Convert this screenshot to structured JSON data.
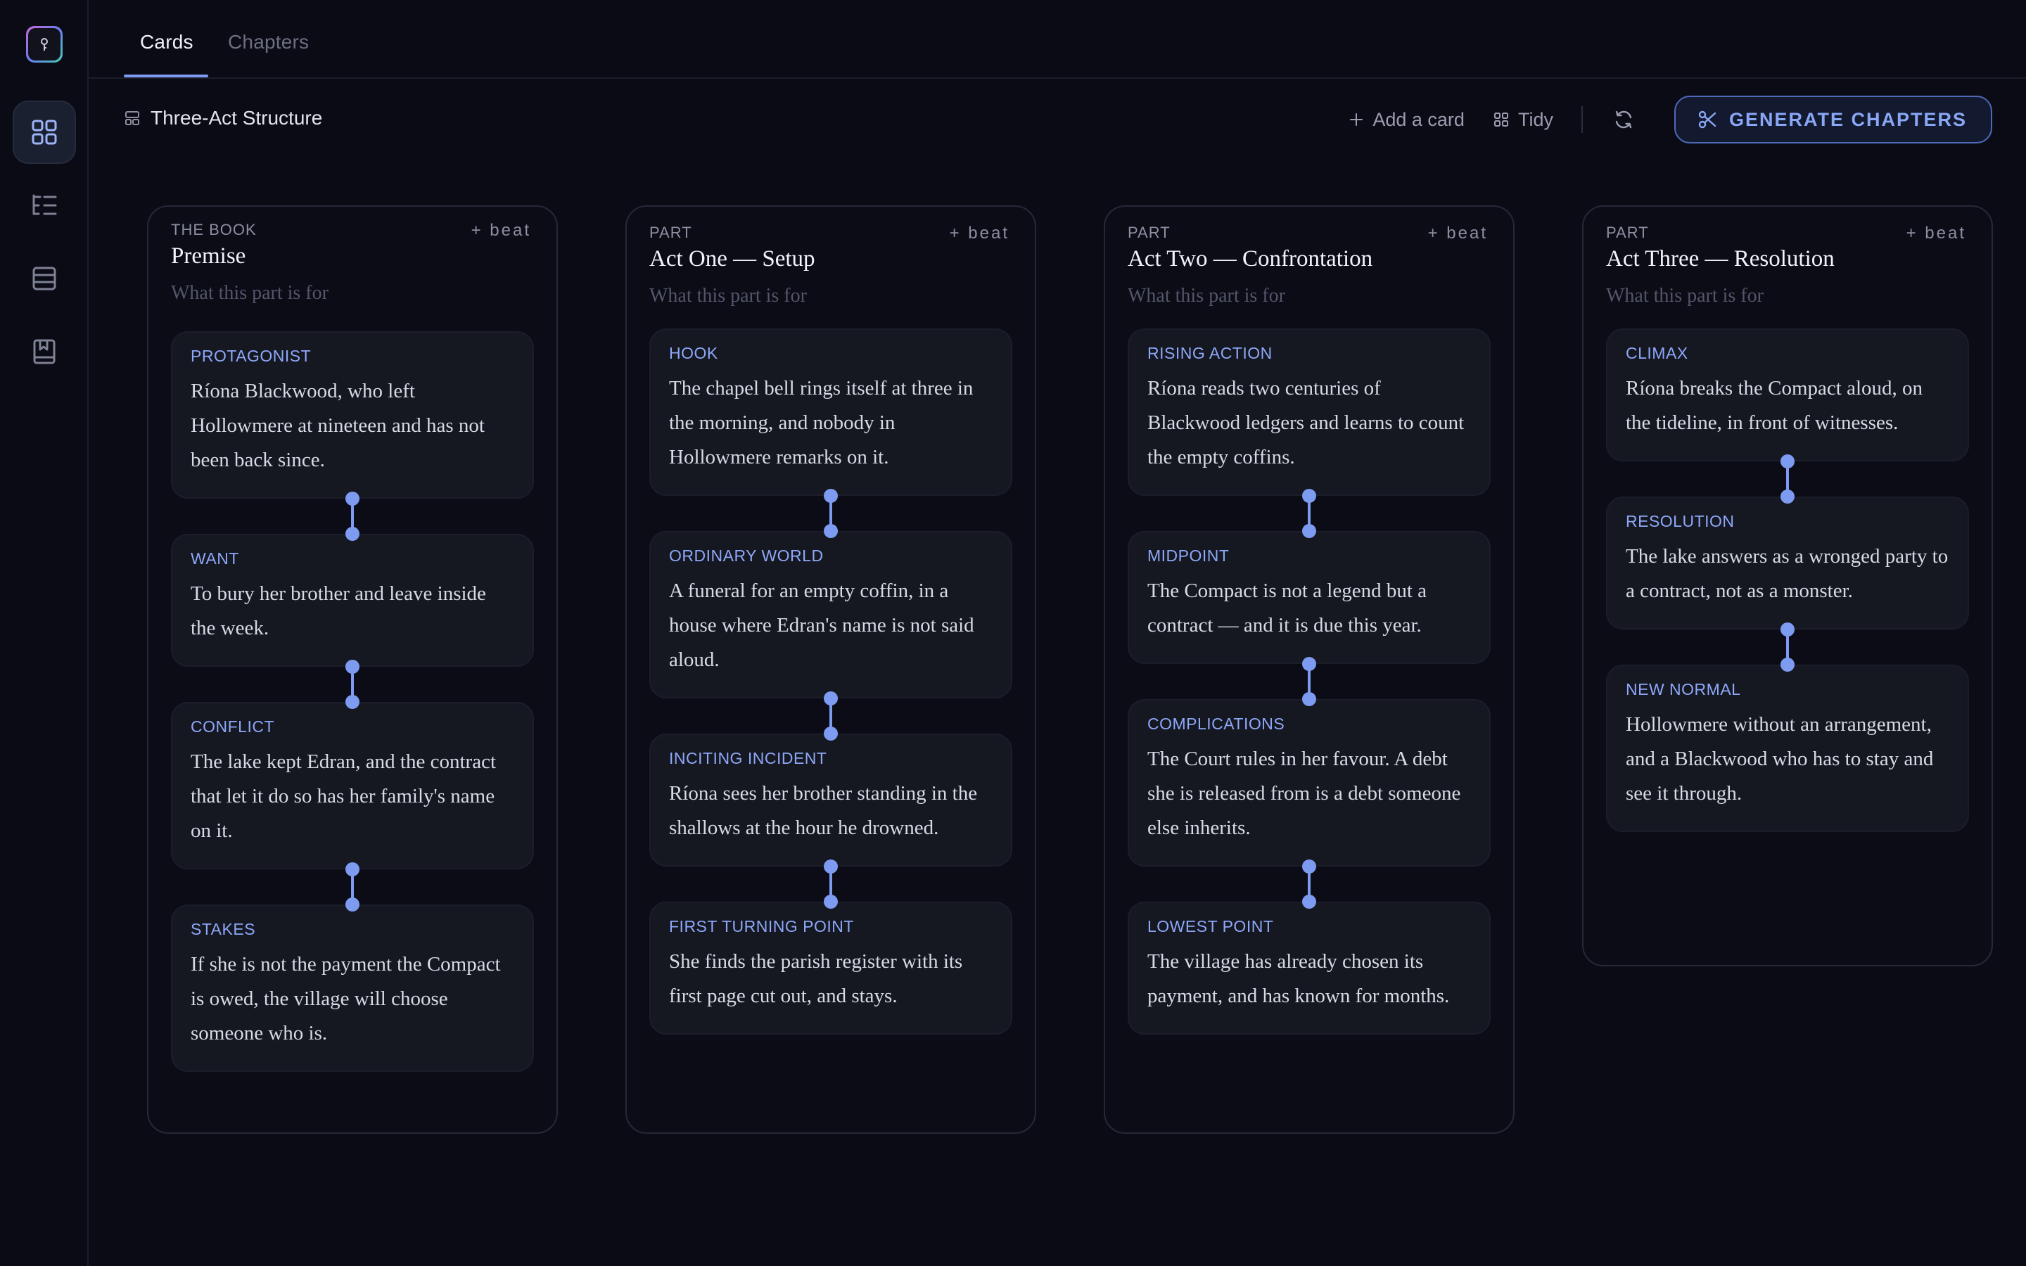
{
  "tabs": [
    {
      "label": "Cards",
      "active": true
    },
    {
      "label": "Chapters",
      "active": false
    }
  ],
  "sidebar": {
    "items": [
      {
        "icon": "grid-icon",
        "active": true
      },
      {
        "icon": "outline-list-icon",
        "active": false
      },
      {
        "icon": "table-rows-icon",
        "active": false
      },
      {
        "icon": "bookmark-book-icon",
        "active": false
      }
    ]
  },
  "toolbar": {
    "structure_label": "Three-Act Structure",
    "add_card_label": "Add a card",
    "tidy_label": "Tidy",
    "generate_label": "GENERATE CHAPTERS"
  },
  "colors": {
    "accent": "#7e9bf2",
    "background": "#0a0b14",
    "card": "#151721"
  },
  "columns": [
    {
      "kind": "THE BOOK",
      "add_beat": "+ beat",
      "title": "Premise",
      "subtitle": "What this part is for",
      "beats": [
        {
          "label": "PROTAGONIST",
          "text": "Ríona Blackwood, who left Hollowmere at nineteen and has not been back since."
        },
        {
          "label": "WANT",
          "text": "To bury her brother and leave inside the week."
        },
        {
          "label": "CONFLICT",
          "text": "The lake kept Edran, and the contract that let it do so has her family's name on it."
        },
        {
          "label": "STAKES",
          "text": "If she is not the payment the Compact is owed, the village will choose someone who is."
        }
      ]
    },
    {
      "kind": "PART",
      "add_beat": "+ beat",
      "title": "Act One — Setup",
      "subtitle": "What this part is for",
      "beats": [
        {
          "label": "HOOK",
          "text": "The chapel bell rings itself at three in the morning, and nobody in Hollowmere remarks on it."
        },
        {
          "label": "ORDINARY WORLD",
          "text": "A funeral for an empty coffin, in a house where Edran's name is not said aloud."
        },
        {
          "label": "INCITING INCIDENT",
          "text": "Ríona sees her brother standing in the shallows at the hour he drowned."
        },
        {
          "label": "FIRST TURNING POINT",
          "text": "She finds the parish register with its first page cut out, and stays."
        }
      ]
    },
    {
      "kind": "PART",
      "add_beat": "+ beat",
      "title": "Act Two — Confrontation",
      "subtitle": "What this part is for",
      "beats": [
        {
          "label": "RISING ACTION",
          "text": "Ríona reads two centuries of Blackwood ledgers and learns to count the empty coffins."
        },
        {
          "label": "MIDPOINT",
          "text": "The Compact is not a legend but a contract — and it is due this year."
        },
        {
          "label": "COMPLICATIONS",
          "text": "The Court rules in her favour. A debt she is released from is a debt someone else inherits."
        },
        {
          "label": "LOWEST POINT",
          "text": "The village has already chosen its payment, and has known for months."
        }
      ]
    },
    {
      "kind": "PART",
      "add_beat": "+ beat",
      "title": "Act Three — Resolution",
      "subtitle": "What this part is for",
      "beats": [
        {
          "label": "CLIMAX",
          "text": "Ríona breaks the Compact aloud, on the tideline, in front of witnesses."
        },
        {
          "label": "RESOLUTION",
          "text": "The lake answers as a wronged party to a contract, not as a monster."
        },
        {
          "label": "NEW NORMAL",
          "text": "Hollowmere without an arrangement, and a Blackwood who has to stay and see it through."
        }
      ]
    }
  ]
}
